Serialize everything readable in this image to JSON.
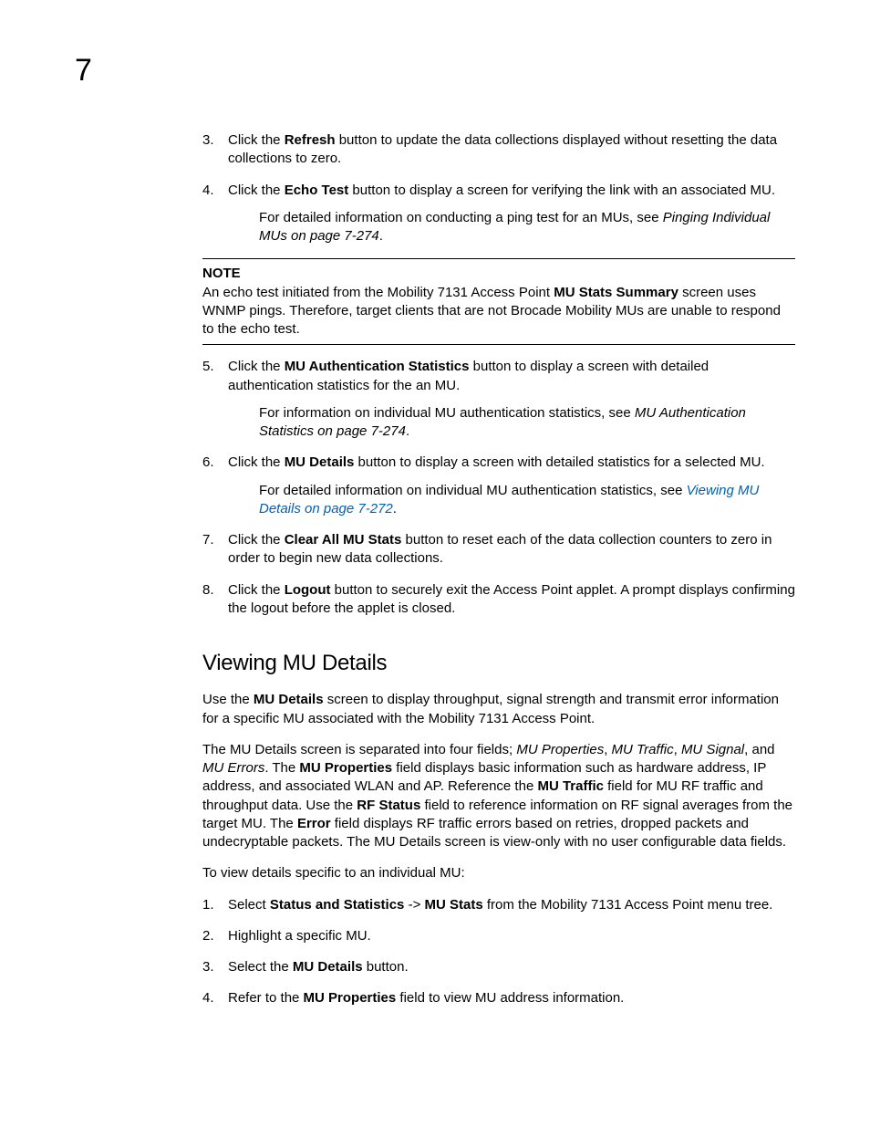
{
  "chapter_number": "7",
  "steps_a": [
    {
      "num": "3.",
      "pre": "Click the ",
      "bold": "Refresh",
      "post": " button to update the data collections displayed without resetting the data collections to zero."
    },
    {
      "num": "4.",
      "pre": "Click the ",
      "bold": "Echo Test",
      "post": " button to display a screen for verifying the link with an associated MU.",
      "sub_pre": "For detailed information on conducting a ping test for an MUs, see ",
      "sub_ital": "Pinging Individual MUs on page 7-274",
      "sub_post": "."
    }
  ],
  "note": {
    "label": "NOTE",
    "text_pre": "An echo test initiated from the Mobility 7131 Access Point ",
    "text_bold": "MU Stats Summary",
    "text_post": " screen uses WNMP pings. Therefore, target clients that are not Brocade Mobility MUs are unable to respond to the echo test."
  },
  "steps_b": [
    {
      "num": "5.",
      "pre": "Click the ",
      "bold": "MU Authentication Statistics",
      "post": " button to display a screen with detailed authentication statistics for the an MU.",
      "sub_pre": "For information on individual MU authentication statistics, see ",
      "sub_ital": "MU Authentication Statistics on page 7-274",
      "sub_post": "."
    },
    {
      "num": "6.",
      "pre": "Click the ",
      "bold": "MU Details",
      "post": " button to display a screen with detailed statistics for a selected MU.",
      "sub_pre": "For detailed information on individual MU authentication statistics, see ",
      "sub_link": "Viewing MU Details on page 7-272",
      "sub_post": "."
    },
    {
      "num": "7.",
      "pre": "Click the ",
      "bold": "Clear All MU Stats",
      "post": " button to reset each of the data collection counters to zero in order to begin new data collections."
    },
    {
      "num": "8.",
      "pre": "Click the ",
      "bold": "Logout",
      "post": " button to securely exit the Access Point applet. A prompt displays confirming the logout before the applet is closed."
    }
  ],
  "section_heading": "Viewing MU Details",
  "para1": {
    "p1": "Use the ",
    "b1": "MU Details",
    "p2": " screen to display throughput, signal strength and transmit error information for a specific MU associated with the Mobility 7131 Access Point."
  },
  "para2": {
    "t1": "The MU Details screen is separated into four fields; ",
    "i1": "MU Properties",
    "t2": ", ",
    "i2": "MU Traffic",
    "t3": ", ",
    "i3": "MU Signal",
    "t4": ", and ",
    "i4": "MU Errors",
    "t5": ". The ",
    "b1": "MU Properties",
    "t6": " field displays basic information such as hardware address, IP address, and associated WLAN and AP. Reference the ",
    "b2": "MU Traffic",
    "t7": " field for MU RF traffic and throughput data. Use the ",
    "b3": "RF Status",
    "t8": " field to reference information on RF signal averages from the target MU. The ",
    "b4": "Error",
    "t9": " field displays RF traffic errors based on retries, dropped packets and undecryptable packets. The MU Details screen is view-only with no user configurable data fields."
  },
  "para3": "To view details specific to an individual MU:",
  "steps_c": [
    {
      "num": "1.",
      "pre": "Select ",
      "bold": "Status and Statistics",
      "mid": " -> ",
      "bold2": "MU Stats",
      "post": " from the Mobility 7131 Access Point menu tree."
    },
    {
      "num": "2.",
      "pre": "Highlight a specific MU.",
      "bold": "",
      "post": ""
    },
    {
      "num": "3.",
      "pre": "Select the ",
      "bold": "MU Details",
      "post": " button."
    },
    {
      "num": "4.",
      "pre": "Refer to the ",
      "bold": "MU Properties",
      "post": " field to view MU address information."
    }
  ]
}
